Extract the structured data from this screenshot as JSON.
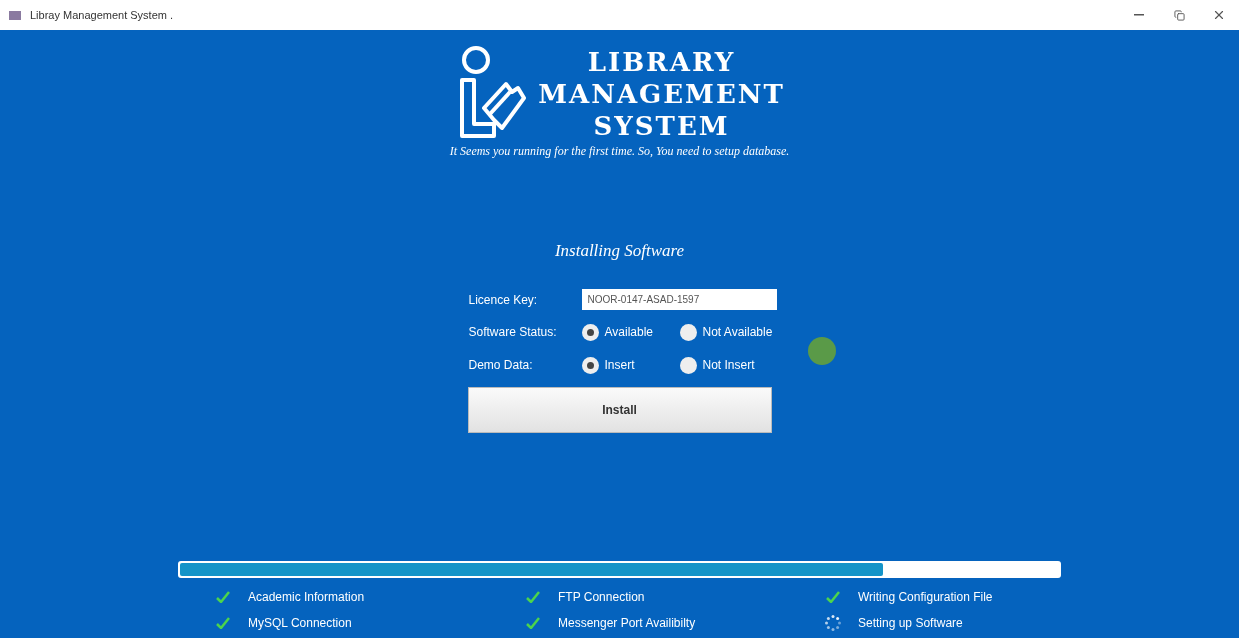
{
  "window": {
    "title": "Libray Management System ."
  },
  "logo": {
    "lines": [
      "LIBRARY",
      "MANAGEMENT",
      "SYSTEM"
    ]
  },
  "subtitle": "It Seems you running  for the first time. So, You need to setup database.",
  "form": {
    "heading": "Installing Software",
    "licence": {
      "label": "Licence Key:",
      "value": "NOOR-0147-ASAD-1597"
    },
    "radio_groups": [
      {
        "label": "Software Status:",
        "options": [
          {
            "label": "Available",
            "selected": true
          },
          {
            "label": "Not Available",
            "selected": false
          }
        ]
      },
      {
        "label": "Demo Data:",
        "options": [
          {
            "label": "Insert",
            "selected": true
          },
          {
            "label": "Not Insert",
            "selected": false
          }
        ]
      }
    ],
    "button": "Install"
  },
  "progress": {
    "level": 0.8
  },
  "steps": [
    {
      "label": "Academic Information",
      "kind": "done"
    },
    {
      "label": "FTP Connection",
      "kind": "done"
    },
    {
      "label": "Writing Configuration File",
      "kind": "done"
    },
    {
      "label": "MySQL Connection",
      "kind": "done"
    },
    {
      "label": "Messenger Port Availibilty",
      "kind": "done"
    },
    {
      "label": "Setting up Software",
      "kind": "running"
    }
  ]
}
